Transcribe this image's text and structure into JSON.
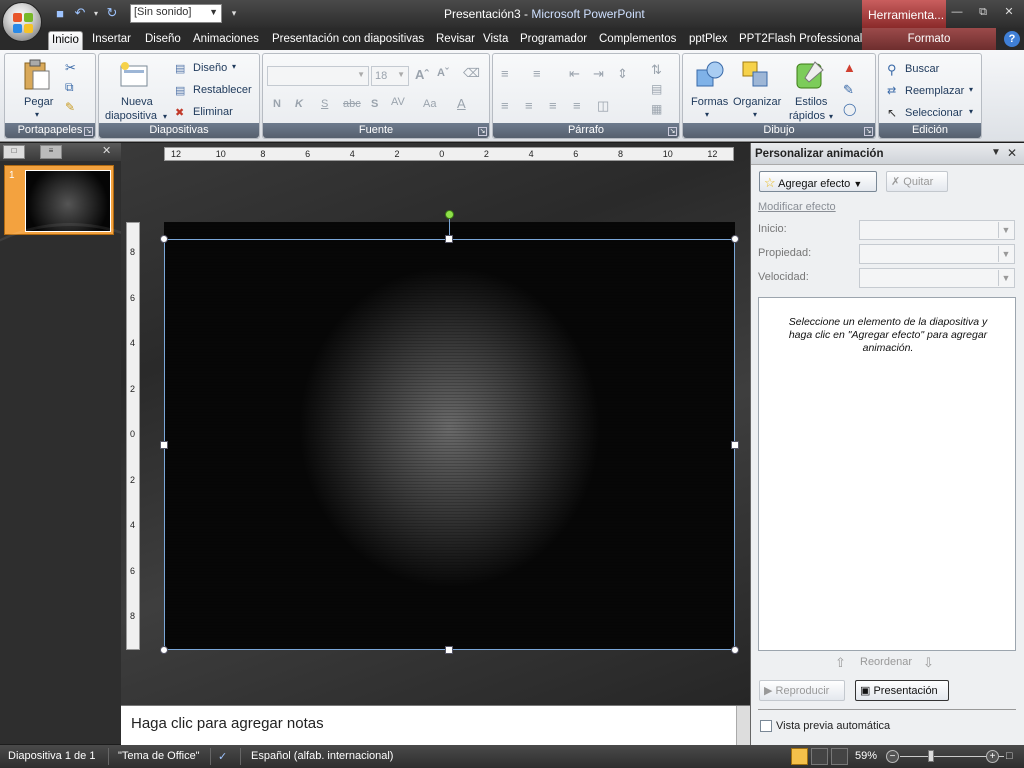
{
  "window": {
    "title_doc": "Presentación3",
    "title_sep": " - ",
    "title_app": "Microsoft PowerPoint",
    "contextual_header": "Herramienta...",
    "sound_select_value": "[Sin sonido]"
  },
  "tabs": [
    {
      "label": "Inicio",
      "active": true
    },
    {
      "label": "Insertar"
    },
    {
      "label": "Diseño"
    },
    {
      "label": "Animaciones"
    },
    {
      "label": "Presentación con diapositivas"
    },
    {
      "label": "Revisar"
    },
    {
      "label": "Vista"
    },
    {
      "label": "Programador"
    },
    {
      "label": "Complementos"
    },
    {
      "label": "pptPlex"
    },
    {
      "label": "PPT2Flash Professional"
    }
  ],
  "contextual_tab": "Formato",
  "ribbon": {
    "portapapeles": {
      "label": "Portapapeles",
      "pegar": "Pegar"
    },
    "diapositivas": {
      "label": "Diapositivas",
      "nueva_1": "Nueva",
      "nueva_2": "diapositiva",
      "diseno": "Diseño",
      "restablecer": "Restablecer",
      "eliminar": "Eliminar"
    },
    "fuente": {
      "label": "Fuente",
      "size": "18"
    },
    "parrafo": {
      "label": "Párrafo"
    },
    "dibujo": {
      "label": "Dibujo",
      "formas": "Formas",
      "organizar": "Organizar",
      "estilos_1": "Estilos",
      "estilos_2": "rápidos"
    },
    "edicion": {
      "label": "Edición",
      "buscar": "Buscar",
      "reemplazar": "Reemplazar",
      "seleccionar": "Seleccionar"
    }
  },
  "thumbnails": [
    {
      "number": "1"
    }
  ],
  "notes": {
    "placeholder": "Haga clic para agregar notas"
  },
  "taskpane": {
    "title": "Personalizar animación",
    "add_effect": "Agregar efecto",
    "remove": "Quitar",
    "modify_section": "Modificar efecto",
    "start_label": "Inicio:",
    "property_label": "Propiedad:",
    "speed_label": "Velocidad:",
    "hint": "Seleccione un elemento de la diapositiva y haga clic en \"Agregar efecto\" para agregar animación.",
    "reorder": "Reordenar",
    "play": "Reproducir",
    "slideshow": "Presentación",
    "autopreview": "Vista previa automática"
  },
  "statusbar": {
    "slide_info": "Diapositiva 1 de 1",
    "theme": "\"Tema de Office\"",
    "language": "Español (alfab. internacional)",
    "zoom": "59%"
  },
  "ruler": {
    "h_labels": [
      "12",
      "10",
      "8",
      "6",
      "4",
      "2",
      "0",
      "2",
      "4",
      "6",
      "8",
      "10",
      "12"
    ],
    "v_labels": [
      "8",
      "6",
      "4",
      "2",
      "0",
      "2",
      "4",
      "6",
      "8"
    ]
  },
  "colors": {
    "accent": "#f3a23f",
    "contextual": "#8a2a2a",
    "rotate_handle": "#8fe04a"
  }
}
